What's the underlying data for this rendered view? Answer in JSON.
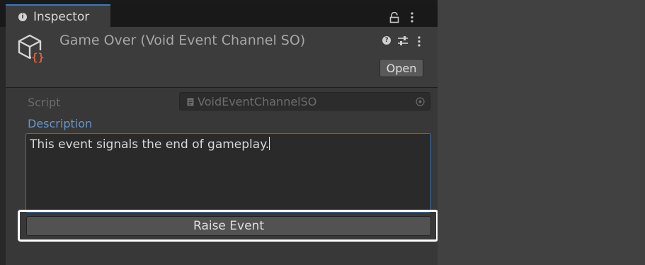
{
  "tab": {
    "label": "Inspector"
  },
  "asset": {
    "title": "Game Over (Void Event Channel SO)"
  },
  "header": {
    "open_label": "Open"
  },
  "fields": {
    "script_label": "Script",
    "script_value": "VoidEventChannelSO",
    "description_label": "Description",
    "description_value": "This event signals the end of gameplay."
  },
  "actions": {
    "raise_event_label": "Raise Event"
  },
  "icons": {
    "tab": "info-icon",
    "lock": "lock-icon",
    "asset": "scriptable-object-icon",
    "help": "help-icon",
    "presets": "presets-icon",
    "menu": "kebab-menu-icon",
    "script_file": "script-file-icon",
    "object_picker": "object-picker-icon"
  },
  "colors": {
    "accent": "#3a79bb",
    "asset_icon_braces": "#e0603a",
    "highlight_outline": "#ffffff"
  }
}
